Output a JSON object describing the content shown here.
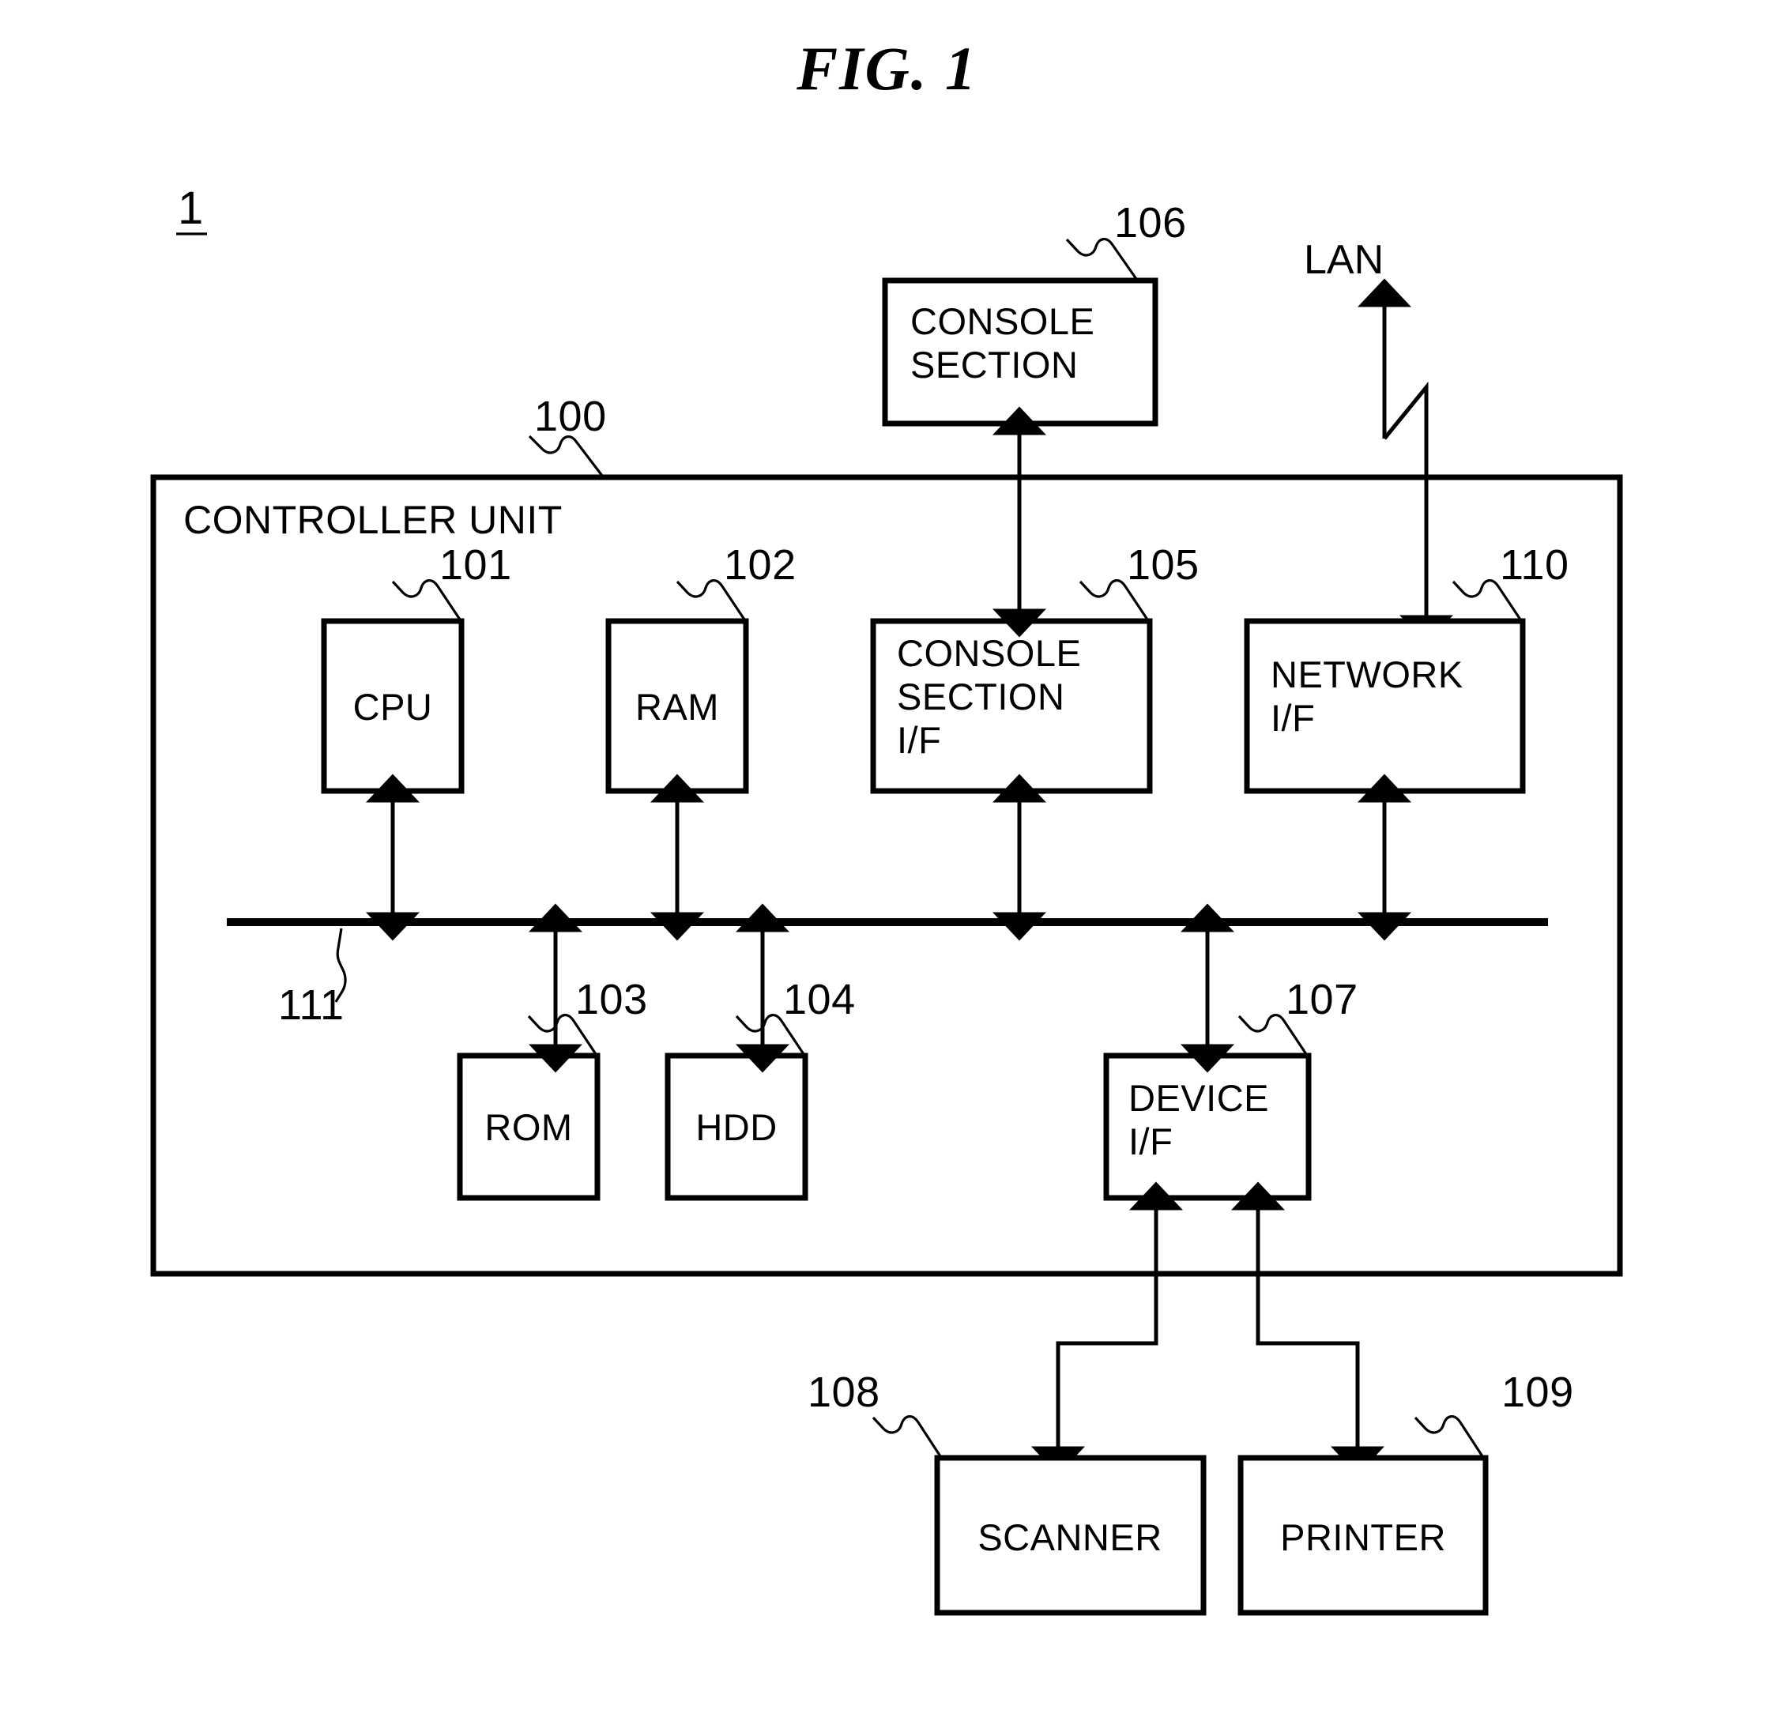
{
  "figure": {
    "title": "FIG. 1",
    "system_label": "1"
  },
  "diagram": {
    "type": "block-diagram",
    "container": {
      "name": "controller-unit",
      "label": "CONTROLLER UNIT",
      "ref": "100"
    },
    "bus": {
      "name": "system-bus",
      "ref": "111"
    },
    "external_link": {
      "label": "LAN"
    },
    "blocks": [
      {
        "id": "console-section",
        "label_lines": [
          "CONSOLE",
          "SECTION"
        ],
        "ref": "106"
      },
      {
        "id": "cpu",
        "label_lines": [
          "CPU"
        ],
        "ref": "101"
      },
      {
        "id": "ram",
        "label_lines": [
          "RAM"
        ],
        "ref": "102"
      },
      {
        "id": "console-section-if",
        "label_lines": [
          "CONSOLE",
          "SECTION",
          "I/F"
        ],
        "ref": "105"
      },
      {
        "id": "network-if",
        "label_lines": [
          "NETWORK",
          "I/F"
        ],
        "ref": "110"
      },
      {
        "id": "rom",
        "label_lines": [
          "ROM"
        ],
        "ref": "103"
      },
      {
        "id": "hdd",
        "label_lines": [
          "HDD"
        ],
        "ref": "104"
      },
      {
        "id": "device-if",
        "label_lines": [
          "DEVICE",
          "I/F"
        ],
        "ref": "107"
      },
      {
        "id": "scanner",
        "label_lines": [
          "SCANNER"
        ],
        "ref": "108"
      },
      {
        "id": "printer",
        "label_lines": [
          "PRINTER"
        ],
        "ref": "109"
      }
    ],
    "connections": [
      {
        "from": "console-section",
        "to": "console-section-if",
        "arrows": "both"
      },
      {
        "from": "cpu",
        "to": "system-bus",
        "arrows": "both"
      },
      {
        "from": "ram",
        "to": "system-bus",
        "arrows": "both"
      },
      {
        "from": "console-section-if",
        "to": "system-bus",
        "arrows": "both"
      },
      {
        "from": "network-if",
        "to": "system-bus",
        "arrows": "both"
      },
      {
        "from": "network-if",
        "to": "LAN",
        "arrows": "both"
      },
      {
        "from": "system-bus",
        "to": "rom",
        "arrows": "both"
      },
      {
        "from": "system-bus",
        "to": "hdd",
        "arrows": "both"
      },
      {
        "from": "system-bus",
        "to": "device-if",
        "arrows": "both"
      },
      {
        "from": "device-if",
        "to": "scanner",
        "arrows": "both"
      },
      {
        "from": "device-if",
        "to": "printer",
        "arrows": "both"
      }
    ],
    "colors": {
      "stroke": "#000000",
      "fill": "#ffffff",
      "background": "#ffffff"
    }
  }
}
